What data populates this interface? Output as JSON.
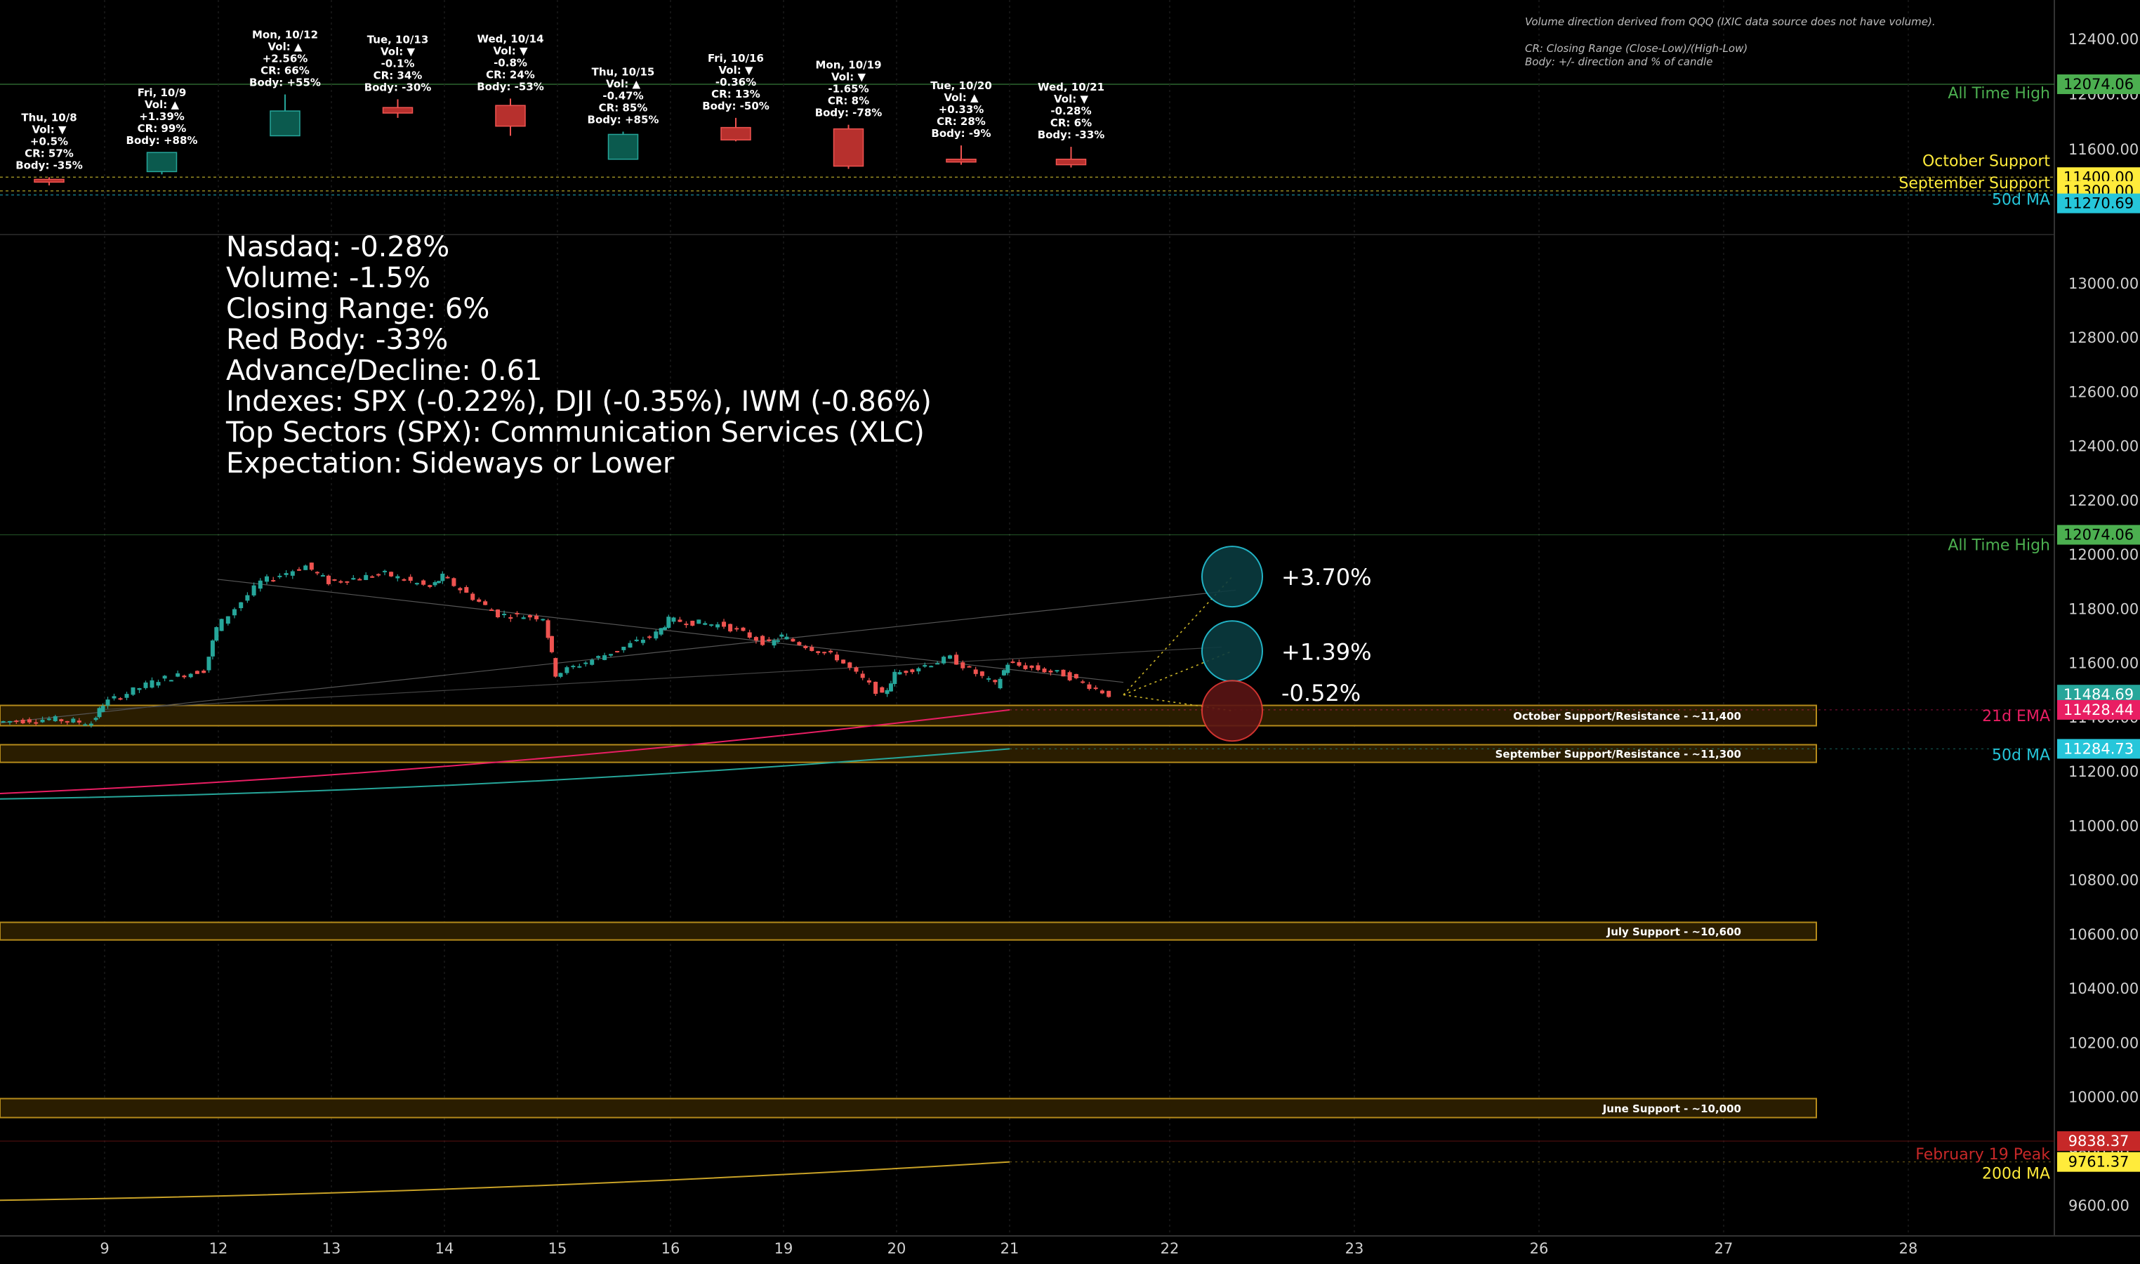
{
  "note": {
    "line1": "Volume direction derived from QQQ (IXIC data source does not have volume).",
    "line2": "CR: Closing Range (Close-Low)/(High-Low)",
    "line3": "Body: +/- direction and % of candle"
  },
  "summary": [
    "Nasdaq: -0.28%",
    "Volume: -1.5%",
    "Closing Range: 6%",
    "Red Body: -33%",
    "Advance/Decline: 0.61",
    "Indexes: SPX (-0.22%), DJI (-0.35%), IWM (-0.86%)",
    "Top Sectors (SPX): Communication Services (XLC)",
    "Expectation: Sideways or Lower"
  ],
  "colors": {
    "up": "#26a69a",
    "up_body": "#0b5a4e",
    "down": "#ef5350",
    "down_body": "#b7302d",
    "green_label": "#4caf50",
    "yellow": "#ffeb3b",
    "cyan": "#26c6da",
    "red": "#e53935",
    "support_fill": "#2a1d00",
    "support_border": "#b58b1b"
  },
  "chart_data": [
    {
      "type": "candlestick",
      "title": "Daily candles with annotations",
      "candles": [
        {
          "label": [
            "Thu, 10/8",
            "Vol: ▼",
            "+0.5%",
            "CR: 57%",
            "Body: -35%"
          ],
          "open": 11384,
          "high": 11400,
          "low": 11340,
          "close": 11364,
          "dir": "down"
        },
        {
          "label": [
            "Fri, 10/9",
            "Vol: ▲",
            "+1.39%",
            "CR: 99%",
            "Body: +88%"
          ],
          "open": 11440,
          "high": 11580,
          "low": 11420,
          "close": 11579,
          "dir": "up"
        },
        {
          "label": [
            "Mon, 10/12",
            "Vol: ▲",
            "+2.56%",
            "CR: 66%",
            "Body: +55%"
          ],
          "open": 11700,
          "high": 12000,
          "low": 11700,
          "close": 11880,
          "dir": "up"
        },
        {
          "label": [
            "Tue, 10/13",
            "Vol: ▼",
            "-0.1%",
            "CR: 34%",
            "Body: -30%"
          ],
          "open": 11905,
          "high": 11965,
          "low": 11830,
          "close": 11865,
          "dir": "down"
        },
        {
          "label": [
            "Wed, 10/14",
            "Vol: ▼",
            "-0.8%",
            "CR: 24%",
            "Body: -53%"
          ],
          "open": 11920,
          "high": 11970,
          "low": 11700,
          "close": 11770,
          "dir": "down"
        },
        {
          "label": [
            "Thu, 10/15",
            "Vol: ▲",
            "-0.47%",
            "CR: 85%",
            "Body: +85%"
          ],
          "open": 11530,
          "high": 11730,
          "low": 11530,
          "close": 11710,
          "dir": "up"
        },
        {
          "label": [
            "Fri, 10/16",
            "Vol: ▼",
            "-0.36%",
            "CR: 13%",
            "Body: -50%"
          ],
          "open": 11760,
          "high": 11830,
          "low": 11660,
          "close": 11670,
          "dir": "down"
        },
        {
          "label": [
            "Mon, 10/19",
            "Vol: ▼",
            "-1.65%",
            "CR: 8%",
            "Body: -78%"
          ],
          "open": 11750,
          "high": 11780,
          "low": 11460,
          "close": 11480,
          "dir": "down"
        },
        {
          "label": [
            "Tue, 10/20",
            "Vol: ▲",
            "+0.33%",
            "CR: 28%",
            "Body: -9%"
          ],
          "open": 11530,
          "high": 11630,
          "low": 11490,
          "close": 11520,
          "dir": "down"
        },
        {
          "label": [
            "Wed, 10/21",
            "Vol: ▼",
            "-0.28%",
            "CR: 6%",
            "Body: -33%"
          ],
          "open": 11530,
          "high": 11620,
          "low": 11470,
          "close": 11490,
          "dir": "down"
        }
      ],
      "y_axis_ticks": [
        11600,
        12000,
        12400
      ],
      "levels": [
        {
          "name": "All Time High",
          "value": 12074.06,
          "color": "#4caf50",
          "badge": "12074.06"
        },
        {
          "name": "October Support",
          "value": 11400,
          "color": "#ffeb3b",
          "badge": "11400.00"
        },
        {
          "name": "September Support",
          "value": 11300,
          "color": "#ffeb3b",
          "badge": "11300.00"
        },
        {
          "name": "50d MA",
          "value": 11270.69,
          "color": "#26c6da",
          "badge": "11270.69"
        }
      ]
    },
    {
      "type": "intraday-line",
      "title": "Intraday price with support zones",
      "ylim": [
        9520,
        13150
      ],
      "y_axis_ticks": [
        13000,
        12800,
        12600,
        12400,
        12200,
        12000,
        11800,
        11600,
        11400,
        11200,
        11000,
        10800,
        10600,
        10400,
        10200,
        10000,
        9800,
        9600
      ],
      "x_ticks": [
        "9",
        "12",
        "13",
        "14",
        "15",
        "16",
        "19",
        "20",
        "21",
        "22",
        "23",
        "26",
        "27",
        "28"
      ],
      "price_path": [
        {
          "day": 0,
          "v": 11384
        },
        {
          "day": 0.5,
          "v": 11395
        },
        {
          "day": 0.9,
          "v": 11380
        },
        {
          "day": 1,
          "v": 11450
        },
        {
          "day": 1.5,
          "v": 11540
        },
        {
          "day": 1.9,
          "v": 11575
        },
        {
          "day": 2,
          "v": 11730
        },
        {
          "day": 2.4,
          "v": 11900
        },
        {
          "day": 2.8,
          "v": 11960
        },
        {
          "day": 3,
          "v": 11900
        },
        {
          "day": 3.5,
          "v": 11930
        },
        {
          "day": 3.9,
          "v": 11880
        },
        {
          "day": 4,
          "v": 11920
        },
        {
          "day": 4.5,
          "v": 11780
        },
        {
          "day": 4.9,
          "v": 11770
        },
        {
          "day": 5,
          "v": 11560
        },
        {
          "day": 5.5,
          "v": 11640
        },
        {
          "day": 5.9,
          "v": 11710
        },
        {
          "day": 6,
          "v": 11760
        },
        {
          "day": 6.5,
          "v": 11740
        },
        {
          "day": 6.9,
          "v": 11670
        },
        {
          "day": 7,
          "v": 11700
        },
        {
          "day": 7.5,
          "v": 11620
        },
        {
          "day": 7.9,
          "v": 11480
        },
        {
          "day": 8,
          "v": 11560
        },
        {
          "day": 8.5,
          "v": 11620
        },
        {
          "day": 8.9,
          "v": 11520
        },
        {
          "day": 9,
          "v": 11600
        },
        {
          "day": 9.5,
          "v": 11560
        },
        {
          "day": 9.9,
          "v": 11485
        }
      ],
      "moving_averages": [
        {
          "name": "21d EMA",
          "color": "#e91e63",
          "from": 11120,
          "to": 11428.44
        },
        {
          "name": "50d MA",
          "color": "#26a69a",
          "from": 11100,
          "to": 11284.73
        },
        {
          "name": "200d MA",
          "color": "#c9a227",
          "from": 9620,
          "to": 9761.37
        }
      ],
      "zones": [
        {
          "label": "October Support/Resistance - ~11,400",
          "low": 11370,
          "high": 11445
        },
        {
          "label": "September Support/Resistance - ~11,300",
          "low": 11235,
          "high": 11300
        },
        {
          "label": "July Support - ~10,600",
          "low": 10580,
          "high": 10645
        },
        {
          "label": "June Support - ~10,000",
          "low": 9925,
          "high": 9995
        }
      ],
      "projections": [
        {
          "label": "+3.70%",
          "value": 11920,
          "color": "#26c6da"
        },
        {
          "label": "+1.39%",
          "value": 11645,
          "color": "#26c6da"
        },
        {
          "label": "-0.52%",
          "value": 11425,
          "color": "#e53935"
        }
      ],
      "right_labels": [
        {
          "name": "All Time High",
          "value": 12074.06,
          "color": "#4caf50",
          "badge": "12074.06"
        },
        {
          "name": "",
          "value": 11484.69,
          "color": "#26a69a",
          "badge": "11484.69"
        },
        {
          "name": "21d EMA",
          "value": 11428.44,
          "color": "#e91e63",
          "badge": "11428.44"
        },
        {
          "name": "50d MA",
          "value": 11284.73,
          "color": "#26c6da",
          "badge": "11284.73"
        },
        {
          "name": "February 19 Peak",
          "value": 9838.37,
          "color": "#c62828",
          "badge": "9838.37"
        },
        {
          "name": "200d MA",
          "value": 9761.37,
          "color": "#ffeb3b",
          "badge": "9761.37"
        }
      ]
    }
  ]
}
